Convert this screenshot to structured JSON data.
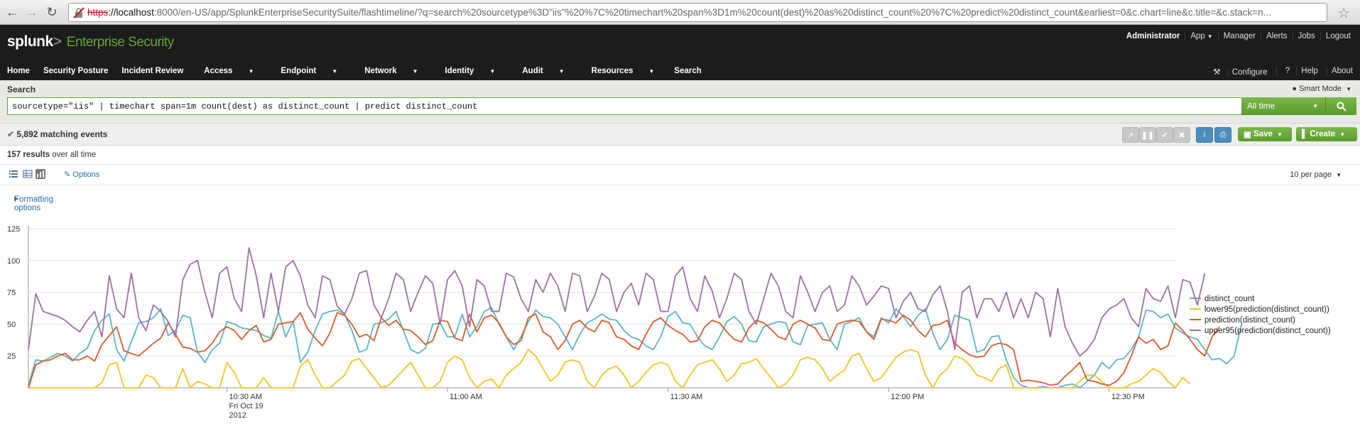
{
  "browser": {
    "url_protocol": "https",
    "url_host": "://localhost",
    "url_rest": ":8000/en-US/app/SplunkEnterpriseSecuritySuite/flashtimeline/?q=search%20sourcetype%3D\"iis\"%20%7C%20timechart%20span%3D1m%20count(dest)%20as%20distinct_count%20%7C%20predict%20distinct_count&earliest=0&c.chart=line&c.title=&c.stack=n..."
  },
  "header": {
    "logo": "splunk",
    "logo_sep": ">",
    "app_name": "Enterprise Security",
    "top_links": [
      "Administrator",
      "App",
      "Manager",
      "Alerts",
      "Jobs",
      "Logout"
    ]
  },
  "nav": {
    "items": [
      "Home",
      "Security Posture",
      "Incident Review",
      "Access",
      "Endpoint",
      "Network",
      "Identity",
      "Audit",
      "Resources",
      "Search"
    ],
    "right": [
      "Configure",
      "Help",
      "About"
    ]
  },
  "search": {
    "label": "Search",
    "mode": "Smart Mode",
    "query": "sourcetype=\"iis\" | timechart span=1m count(dest) as distinct_count | predict distinct_count",
    "time_range": "All time"
  },
  "status": {
    "matching_events": "5,892 matching events",
    "save_label": "Save",
    "create_label": "Create"
  },
  "results": {
    "count": "157 results",
    "suffix": " over all time",
    "options_label": "Options",
    "per_page": "10 per page",
    "formatting_label": "Formatting options"
  },
  "chart_data": {
    "type": "line",
    "ylim": [
      0,
      125
    ],
    "yticks": [
      25,
      50,
      75,
      100,
      125
    ],
    "xticks": [
      {
        "index": 27,
        "label": "10:30 AM",
        "sub1": "Fri Oct 19",
        "sub2": "2012"
      },
      {
        "index": 57,
        "label": "11:00 AM"
      },
      {
        "index": 87,
        "label": "11:30 AM"
      },
      {
        "index": 117,
        "label": "12:00 PM"
      },
      {
        "index": 147,
        "label": "12:30 PM"
      }
    ],
    "n_points": 157,
    "series": [
      {
        "name": "distinct_count",
        "color": "#5ab4c8",
        "values": [
          2,
          22,
          21,
          24,
          27,
          25,
          21,
          27,
          31,
          45,
          53,
          58,
          30,
          21,
          36,
          51,
          52,
          55,
          62,
          41,
          45,
          57,
          55,
          28,
          20,
          30,
          35,
          52,
          50,
          47,
          46,
          45,
          41,
          39,
          60,
          40,
          52,
          20,
          28,
          45,
          58,
          60,
          61,
          58,
          45,
          28,
          30,
          50,
          51,
          54,
          60,
          45,
          30,
          27,
          31,
          50,
          51,
          40,
          40,
          58,
          40,
          48,
          60,
          63,
          50,
          40,
          30,
          40,
          52,
          61,
          56,
          55,
          50,
          40,
          30,
          42,
          51,
          54,
          58,
          54,
          53,
          45,
          40,
          38,
          33,
          30,
          40,
          56,
          60,
          51,
          50,
          40,
          33,
          30,
          40,
          52,
          56,
          50,
          37,
          36,
          48,
          50,
          52,
          51,
          36,
          34,
          49,
          50,
          51,
          38,
          30,
          50,
          52,
          55,
          44,
          40,
          55,
          51,
          62,
          56,
          48,
          57,
          62,
          43,
          30,
          38,
          57,
          55,
          53,
          28,
          30,
          40,
          41,
          22,
          8,
          2,
          0,
          0,
          1,
          0,
          0,
          2,
          3,
          0,
          5,
          10,
          20,
          15,
          22,
          23,
          30,
          40,
          61,
          60,
          55,
          58,
          47,
          43,
          40,
          38,
          30,
          22,
          23,
          19,
          25,
          50
        ]
      },
      {
        "name": "lower95(prediction(distinct_count))",
        "color": "#f5c324",
        "values": [
          0,
          0,
          0,
          0,
          0,
          0,
          0,
          0,
          0,
          0,
          4,
          18,
          20,
          0,
          0,
          0,
          10,
          8,
          0,
          0,
          0,
          15,
          0,
          5,
          3,
          0,
          0,
          20,
          12,
          0,
          0,
          0,
          8,
          0,
          0,
          0,
          0,
          17,
          22,
          10,
          0,
          0,
          5,
          10,
          21,
          23,
          15,
          8,
          0,
          2,
          8,
          14,
          20,
          10,
          0,
          0,
          5,
          20,
          25,
          22,
          8,
          0,
          5,
          7,
          0,
          10,
          15,
          20,
          30,
          25,
          15,
          5,
          10,
          20,
          22,
          20,
          5,
          0,
          10,
          15,
          17,
          10,
          0,
          5,
          12,
          18,
          20,
          18,
          5,
          0,
          10,
          18,
          20,
          22,
          15,
          5,
          10,
          19,
          20,
          23,
          15,
          8,
          0,
          3,
          10,
          22,
          24,
          22,
          15,
          5,
          10,
          14,
          25,
          27,
          15,
          5,
          8,
          16,
          24,
          28,
          30,
          28,
          10,
          0,
          10,
          15,
          25,
          23,
          18,
          10,
          8,
          5,
          15,
          18,
          0,
          0,
          0,
          0,
          0,
          0,
          0,
          0,
          0,
          5,
          10,
          10,
          5,
          0,
          0,
          0,
          3,
          5,
          10,
          15,
          12,
          5,
          0,
          8,
          3
        ]
      },
      {
        "name": "prediction(distinct_count)",
        "color": "#e05a2b",
        "values": [
          0,
          18,
          21,
          22,
          25,
          27,
          22,
          22,
          25,
          21,
          34,
          41,
          48,
          29,
          27,
          25,
          30,
          35,
          39,
          51,
          42,
          32,
          31,
          28,
          29,
          35,
          44,
          48,
          45,
          38,
          45,
          49,
          36,
          38,
          50,
          51,
          52,
          59,
          46,
          39,
          33,
          43,
          59,
          57,
          50,
          40,
          42,
          37,
          55,
          49,
          53,
          46,
          45,
          40,
          34,
          37,
          53,
          52,
          39,
          37,
          58,
          44,
          55,
          57,
          51,
          40,
          34,
          37,
          55,
          58,
          44,
          40,
          30,
          37,
          50,
          53,
          47,
          44,
          53,
          51,
          40,
          38,
          33,
          30,
          42,
          52,
          55,
          49,
          45,
          42,
          36,
          37,
          48,
          53,
          51,
          44,
          38,
          36,
          47,
          53,
          51,
          46,
          40,
          38,
          50,
          53,
          50,
          47,
          38,
          37,
          50,
          52,
          53,
          52,
          44,
          38,
          54,
          53,
          51,
          57,
          53,
          45,
          40,
          49,
          50,
          53,
          35,
          30,
          26,
          24,
          25,
          33,
          35,
          34,
          30,
          5,
          6,
          5,
          4,
          2,
          3,
          9,
          14,
          20,
          6,
          5,
          3,
          2,
          5,
          12,
          25,
          40,
          35,
          38,
          30,
          33,
          51,
          45,
          38,
          30,
          25,
          40,
          48
        ]
      },
      {
        "name": "upper95(prediction(distinct_count))",
        "color": "#9e70a6",
        "values": [
          30,
          74,
          60,
          58,
          56,
          53,
          48,
          44,
          53,
          60,
          40,
          88,
          62,
          55,
          90,
          55,
          45,
          65,
          60,
          52,
          40,
          85,
          97,
          100,
          75,
          55,
          90,
          95,
          70,
          60,
          110,
          88,
          55,
          90,
          60,
          95,
          100,
          88,
          65,
          55,
          88,
          85,
          64,
          58,
          70,
          90,
          92,
          65,
          55,
          70,
          90,
          85,
          60,
          75,
          88,
          82,
          50,
          85,
          92,
          80,
          48,
          85,
          80,
          60,
          60,
          90,
          87,
          70,
          60,
          85,
          75,
          90,
          80,
          60,
          90,
          88,
          60,
          72,
          90,
          85,
          60,
          75,
          82,
          65,
          90,
          85,
          60,
          60,
          88,
          95,
          70,
          60,
          88,
          76,
          55,
          70,
          90,
          85,
          60,
          50,
          70,
          90,
          80,
          60,
          55,
          88,
          75,
          60,
          75,
          80,
          60,
          65,
          88,
          80,
          65,
          72,
          80,
          78,
          55,
          68,
          75,
          62,
          60,
          73,
          80,
          60,
          30,
          75,
          80,
          55,
          70,
          70,
          60,
          75,
          55,
          70,
          55,
          75,
          70,
          40,
          78,
          48,
          35,
          25,
          30,
          38,
          55,
          62,
          65,
          70,
          55,
          48,
          78,
          70,
          68,
          80,
          55,
          85,
          83,
          65,
          90
        ]
      }
    ]
  }
}
